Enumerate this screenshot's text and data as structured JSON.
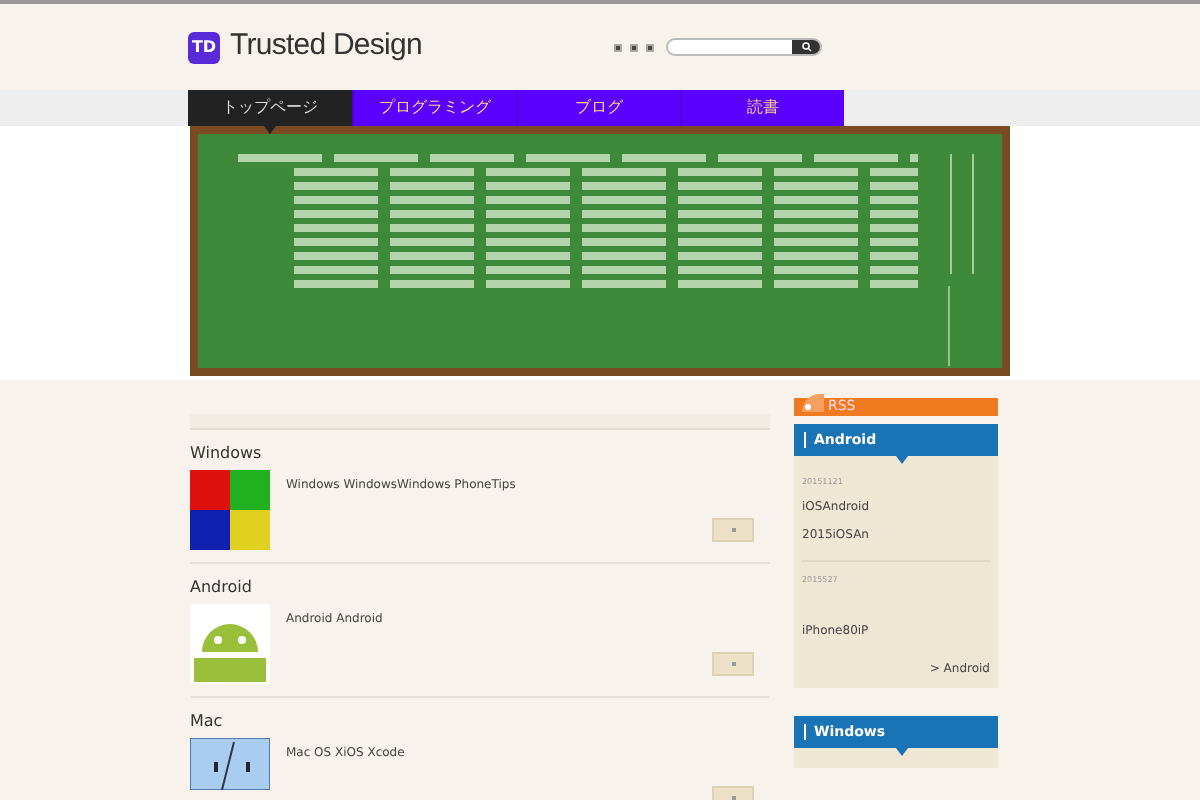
{
  "header": {
    "logo_mark": "TD",
    "site_title": "Trusted Design"
  },
  "nav": [
    {
      "label": "トップページ",
      "selected": true
    },
    {
      "label": "プログラミング",
      "selected": false
    },
    {
      "label": "ブログ",
      "selected": false
    },
    {
      "label": "読書",
      "selected": false
    }
  ],
  "posts": [
    {
      "category": "Windows",
      "kind": "windows",
      "excerpt": "Windows WindowsWindows PhoneTips"
    },
    {
      "category": "Android",
      "kind": "android",
      "excerpt": "Android Android"
    },
    {
      "category": "Mac",
      "kind": "mac",
      "excerpt": "Mac OS XiOS Xcode"
    }
  ],
  "sidebar": {
    "rss": "RSS",
    "widgets": [
      {
        "title": "Android",
        "entries": [
          {
            "date": "20151121",
            "lines": [
              "iOSAndroid",
              "2015iOSAn"
            ]
          },
          {
            "date": "2015527",
            "lines": [
              "iPhone80iP"
            ]
          }
        ],
        "more": "> Android"
      },
      {
        "title": "Windows"
      }
    ]
  }
}
